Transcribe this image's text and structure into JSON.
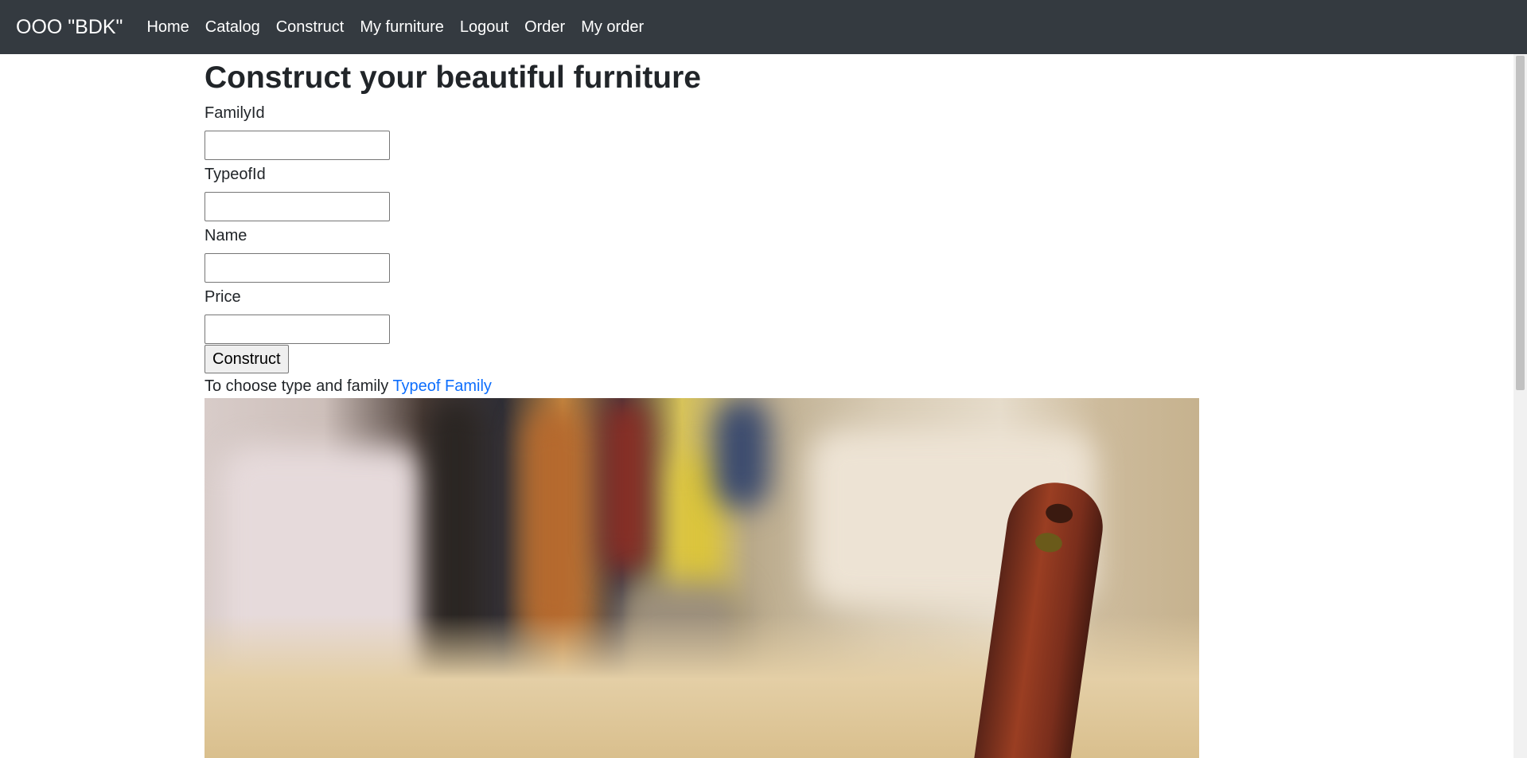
{
  "navbar": {
    "brand": "OOO \"BDK\"",
    "links": [
      "Home",
      "Catalog",
      "Construct",
      "My furniture",
      "Logout",
      "Order",
      "My order"
    ]
  },
  "main": {
    "title": "Construct your beautiful furniture",
    "fields": [
      {
        "label": "FamilyId",
        "value": ""
      },
      {
        "label": "TypeofId",
        "value": ""
      },
      {
        "label": "Name",
        "value": ""
      },
      {
        "label": "Price",
        "value": ""
      }
    ],
    "submit_label": "Construct",
    "hint_text": "To choose type and family ",
    "hint_link": "Typeof Family"
  },
  "colors": {
    "navbar_bg": "#343a40",
    "link": "#0d6efd"
  }
}
